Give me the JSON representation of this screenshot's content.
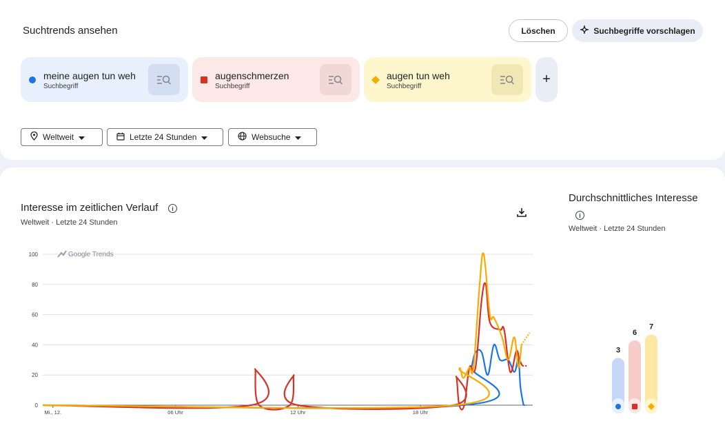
{
  "header": {
    "title": "Suchtrends ansehen",
    "clear_label": "Löschen",
    "suggest_label": "Suchbegriffe vorschlagen"
  },
  "terms": [
    {
      "name": "meine augen tun weh",
      "sub": "Suchbegriff",
      "color": "#1a73e8",
      "bg": "#e8f0fe",
      "marker": "circle"
    },
    {
      "name": "augenschmerzen",
      "sub": "Suchbegriff",
      "color": "#d93025",
      "bg": "#fce8e6",
      "marker": "square"
    },
    {
      "name": "augen tun weh",
      "sub": "Suchbegriff",
      "color": "#f9ab00",
      "bg": "#fef7cd",
      "marker": "diamond"
    }
  ],
  "filters": {
    "region": "Weltweit",
    "time": "Letzte 24 Stunden",
    "type": "Websuche"
  },
  "chart_section": {
    "title": "Interesse im zeitlichen Verlauf",
    "subtitle": "Weltweit · Letzte 24 Stunden",
    "watermark": "Google Trends"
  },
  "avg_section": {
    "title": "Durchschnittliches Interesse",
    "subtitle": "Weltweit · Letzte 24 Stunden"
  },
  "icons": [
    "location-icon",
    "calendar-icon",
    "globe-icon",
    "dropdown-arrow-icon",
    "search-list-icon",
    "sparkle-icon",
    "download-icon",
    "info-icon",
    "plus-icon"
  ],
  "chart_data": [
    {
      "type": "line",
      "title": "Interesse im zeitlichen Verlauf",
      "x_ticks": [
        "Mi., 12.",
        "06 Uhr",
        "12 Uhr",
        "18 Uhr"
      ],
      "y_ticks": [
        0,
        20,
        40,
        60,
        80,
        100
      ],
      "ylim": [
        0,
        100
      ],
      "xlim": [
        0,
        24
      ],
      "grid": true,
      "series": [
        {
          "name": "meine augen tun weh",
          "color": "#1a73e8",
          "points": [
            [
              0,
              0
            ],
            [
              20.6,
              0
            ],
            [
              21.0,
              25
            ],
            [
              21.2,
              35
            ],
            [
              21.5,
              35
            ],
            [
              21.8,
              20
            ],
            [
              22.1,
              40
            ],
            [
              22.4,
              30
            ],
            [
              22.8,
              30
            ],
            [
              23.1,
              22
            ],
            [
              23.3,
              30
            ],
            [
              23.4,
              12
            ],
            [
              23.55,
              0
            ]
          ]
        },
        {
          "name": "augenschmerzen",
          "color": "#d93025",
          "points": [
            [
              0,
              0
            ],
            [
              10.2,
              0
            ],
            [
              10.4,
              24
            ],
            [
              10.6,
              0
            ],
            [
              12.1,
              0
            ],
            [
              12.3,
              20
            ],
            [
              12.5,
              0
            ],
            [
              20.1,
              0
            ],
            [
              20.25,
              19
            ],
            [
              20.4,
              0
            ],
            [
              20.65,
              0
            ],
            [
              20.9,
              25
            ],
            [
              21.2,
              25
            ],
            [
              21.5,
              70
            ],
            [
              21.7,
              80
            ],
            [
              21.9,
              55
            ],
            [
              22.4,
              50
            ],
            [
              22.6,
              50
            ],
            [
              22.9,
              22
            ],
            [
              23.2,
              36
            ],
            [
              23.35,
              30
            ],
            [
              23.5,
              26
            ]
          ]
        },
        {
          "name": "augen tun weh",
          "color": "#f9ab00",
          "points": [
            [
              0,
              0
            ],
            [
              20.2,
              0
            ],
            [
              20.4,
              24
            ],
            [
              20.6,
              18
            ],
            [
              20.9,
              25
            ],
            [
              21.1,
              25
            ],
            [
              21.4,
              80
            ],
            [
              21.6,
              100
            ],
            [
              21.9,
              60
            ],
            [
              22.1,
              58
            ],
            [
              22.5,
              45
            ],
            [
              22.8,
              30
            ],
            [
              23.1,
              45
            ],
            [
              23.3,
              25
            ],
            [
              23.45,
              40
            ]
          ]
        }
      ]
    },
    {
      "type": "bar",
      "title": "Durchschnittliches Interesse",
      "categories": [
        "meine augen tun weh",
        "augenschmerzen",
        "augen tun weh"
      ],
      "values": [
        3,
        6,
        7
      ]
    }
  ]
}
